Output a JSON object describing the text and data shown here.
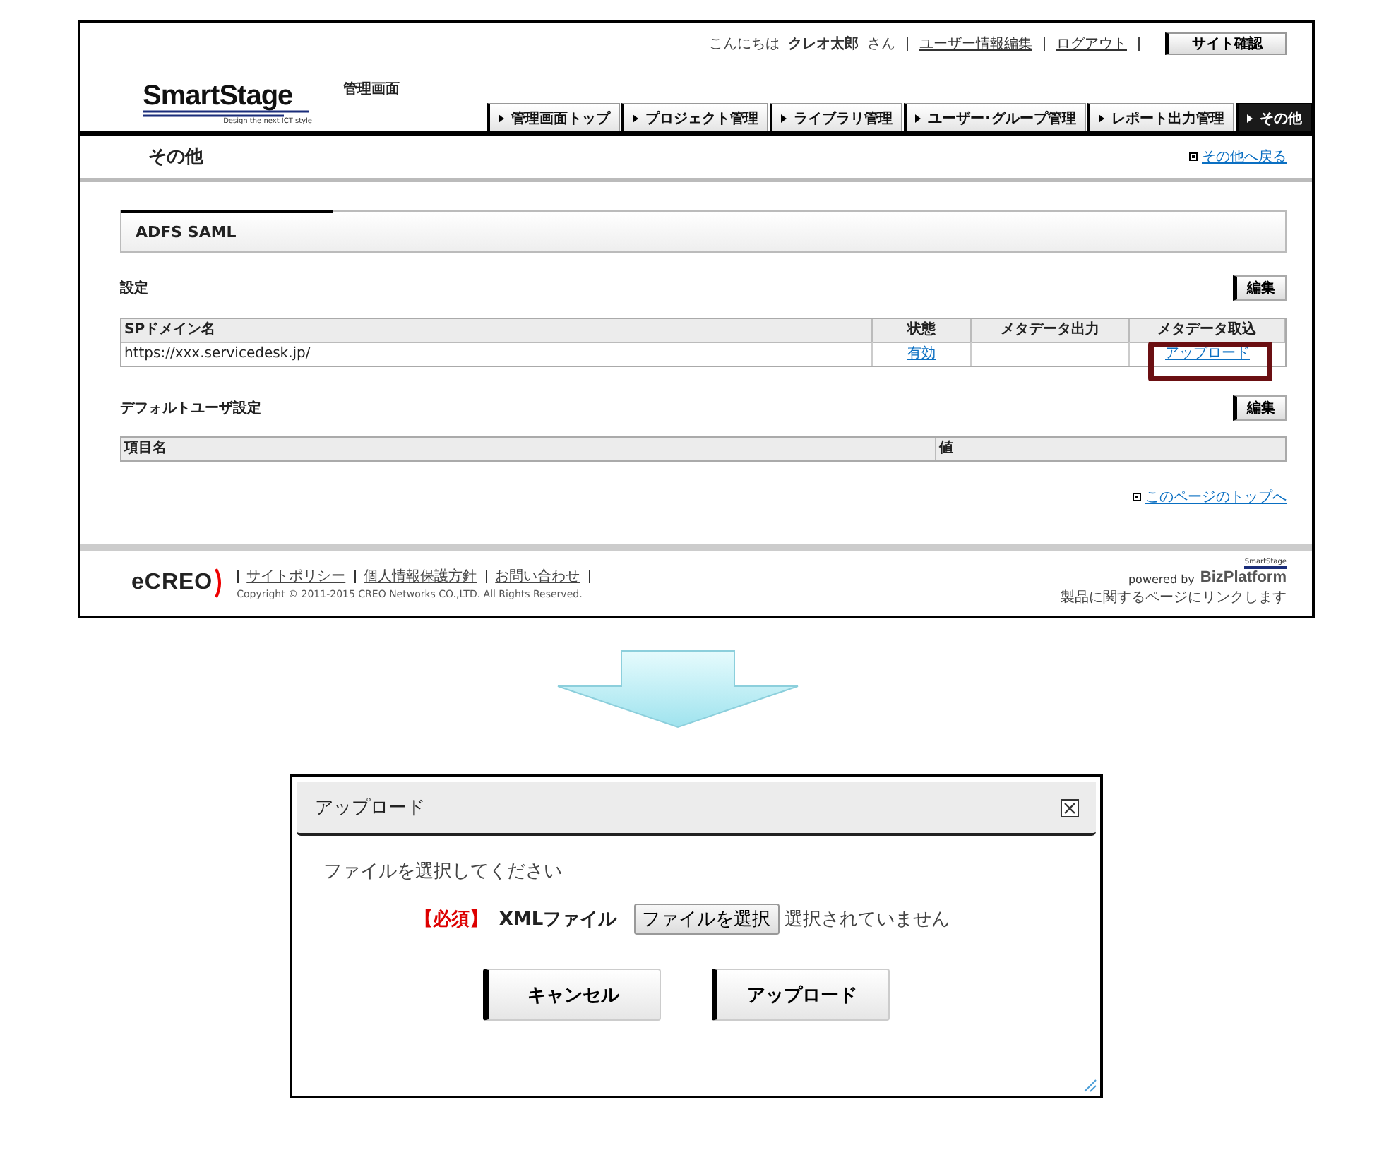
{
  "header": {
    "greeting": "こんにちは",
    "user_name": "クレオ太郎",
    "honorific": "さん",
    "links": [
      "ユーザー情報編集",
      "ログアウト"
    ],
    "site_button": "サイト確認",
    "logo": "SmartStage",
    "logo_tagline": "Design the next ICT style",
    "subtitle": "管理画面"
  },
  "nav_tabs": [
    {
      "label": "管理画面トップ",
      "selected": false
    },
    {
      "label": "プロジェクト管理",
      "selected": false
    },
    {
      "label": "ライブラリ管理",
      "selected": false
    },
    {
      "label": "ユーザー･グループ管理",
      "selected": false
    },
    {
      "label": "レポート出力管理",
      "selected": false
    },
    {
      "label": "その他",
      "selected": true
    }
  ],
  "page": {
    "title": "その他",
    "back_link": "その他へ戻る"
  },
  "section_tab": "ADFS SAML",
  "settings": {
    "title": "設定",
    "edit_button": "編集",
    "columns": [
      "SPドメイン名",
      "状態",
      "メタデータ出力",
      "メタデータ取込"
    ],
    "rows": [
      {
        "sp_domain": "https://xxx.servicedesk.jp/",
        "status": "有効",
        "metadata_import": "アップロード",
        "highlighted": true
      }
    ]
  },
  "default_user": {
    "title": "デフォルトユーザ設定",
    "edit_button": "編集",
    "columns": [
      "項目名",
      "値"
    ]
  },
  "page_top_link": "このページのトップへ",
  "footer": {
    "logo": "eCREO",
    "links": [
      "サイトポリシー",
      "個人情報保護方針",
      "お問い合わせ"
    ],
    "copyright": "Copyright © 2011-2015 CREO Networks CO.,LTD. All Rights Reserved.",
    "powered_by": "powered by",
    "product_brand": "SmartStage",
    "product_logo": "BizPlatform",
    "product_note": "製品に関するページにリンクします"
  },
  "dialog": {
    "title": "アップロード",
    "instruction": "ファイルを選択してください",
    "required_mark": "【必須】",
    "field_label": "XMLファイル",
    "file_button": "ファイルを選択",
    "file_status": "選択されていません",
    "buttons": [
      "キャンセル",
      "アップロード"
    ]
  }
}
